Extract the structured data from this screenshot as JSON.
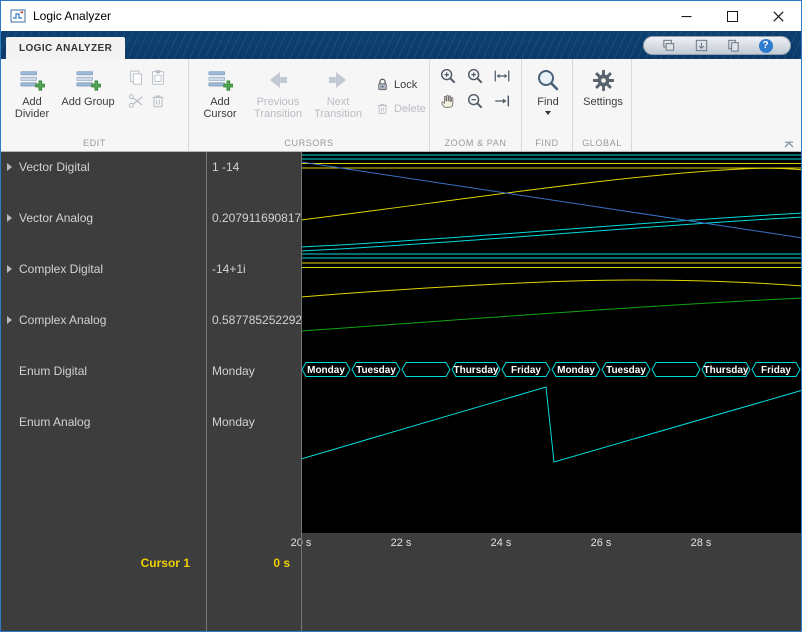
{
  "titlebar": {
    "title": "Logic Analyzer"
  },
  "tabstrip": {
    "active_tab": "LOGIC ANALYZER",
    "help": "?"
  },
  "toolbar": {
    "edit": {
      "label": "EDIT",
      "add_divider": "Add Divider",
      "add_group": "Add Group"
    },
    "cursors": {
      "label": "CURSORS",
      "add_cursor": "Add Cursor",
      "previous_transition": "Previous Transition",
      "next_transition": "Next Transition",
      "lock": "Lock",
      "delete": "Delete"
    },
    "zoom_pan": {
      "label": "ZOOM & PAN"
    },
    "find": {
      "label": "FIND",
      "find": "Find"
    },
    "global": {
      "label": "GLOBAL",
      "settings": "Settings"
    }
  },
  "icons": {
    "edit_mini": [
      "copy",
      "paste",
      "cut",
      "delete"
    ],
    "zoom_pan": [
      "zoom-in-x",
      "zoom-in",
      "fit-to-view",
      "pan",
      "zoom-out",
      "zoom-to-cursor"
    ],
    "quick_access": [
      "cascade-windows",
      "dock",
      "copy-view",
      "help"
    ]
  },
  "signals": [
    {
      "name": "Vector Digital",
      "value": "1 -14"
    },
    {
      "name": "Vector Analog",
      "value": "0.207911690817"
    },
    {
      "name": "Complex Digital",
      "value": "-14+1i"
    },
    {
      "name": "Complex Analog",
      "value": "0.587785252292"
    },
    {
      "name": "Enum Digital",
      "value": "Monday"
    },
    {
      "name": "Enum Analog",
      "value": "Monday"
    }
  ],
  "cursor": {
    "label": "Cursor 1",
    "time": "0 s"
  },
  "waveform": {
    "time_labels": [
      "20 s",
      "22 s",
      "24 s",
      "26 s",
      "28 s"
    ],
    "enum_bus_labels": [
      "Monday",
      "Tuesday",
      "",
      "Thursday",
      "Friday",
      "Monday",
      "Tuesday",
      "",
      "Thursday",
      "Friday"
    ],
    "colors": {
      "cyan": "#00dcdc",
      "yellow": "#e0d400",
      "green": "#15a315",
      "blue": "#3a6fc9",
      "bus_text": "#ffffff",
      "cursor_text": "#f0d000"
    }
  }
}
